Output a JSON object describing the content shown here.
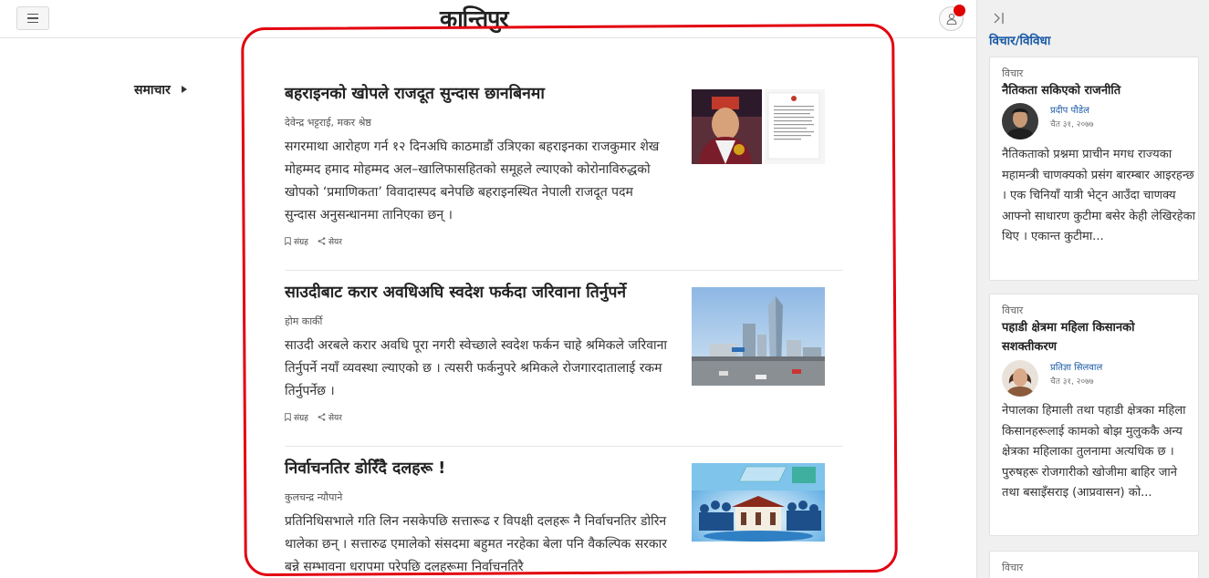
{
  "header": {
    "logo_text": "कान्तिपुर",
    "menu_icon": "hamburger-menu-icon",
    "user_icon": "user-icon"
  },
  "nav": {
    "section_label": "समाचार"
  },
  "articles": [
    {
      "title": "बहराइनको खोपले राजदूत सुन्दास छानबिनमा",
      "authors": "देवेन्द्र भट्टराई, मकर श्रेष्ठ",
      "summary": "सगरमाथा आरोहण गर्न १२ दिनअघि काठमाडौं उत्रिएका बहराइनका राजकुमार शेख मोहम्मद हमाद मोहम्मद अल–खालिफासहितको समूहले ल्याएको कोरोनाविरुद्धको खोपको ‘प्रमाणिकता’ विवादास्पद बनेपछि बहराइनस्थित नेपाली राजदूत पदम सुन्दास अनुसन्धानमा तानिएका छन् ।",
      "save_label": "संग्रह",
      "share_label": "सेयर"
    },
    {
      "title": "साउदीबाट करार अवधिअघि स्वदेश फर्कदा जरिवाना तिर्नुपर्ने",
      "authors": "होम कार्की",
      "summary": "साउदी अरबले करार अवधि पूरा नगरी स्वेच्छाले स्वदेश फर्कन चाहे श्रमिकले जरिवाना तिर्नुपर्ने नयाँ व्यवस्था ल्याएको छ । त्यसरी फर्कनुपरे श्रमिकले रोजगारदातालाई रकम तिर्नुपर्नेछ ।",
      "save_label": "संग्रह",
      "share_label": "सेयर"
    },
    {
      "title": "निर्वाचनतिर डोरिँदै दलहरू !",
      "authors": "कुलचन्द्र न्यौपाने",
      "summary": "प्रतिनिधिसभाले गति लिन नसकेपछि सत्तारूढ र विपक्षी दलहरू नै निर्वाचनतिर डोरिन थालेका छन् । सत्तारुढ एमालेको संसदमा बहुमत नरहेका बेला पनि वैकल्पिक सरकार बन्ने सम्भावना धरापमा परेपछि दलहरूमा निर्वाचनतिरै",
      "save_label": "संग्रह",
      "share_label": "सेयर"
    }
  ],
  "sidebar": {
    "title": "विचार/विविधा",
    "cards": [
      {
        "category": "विचार",
        "title": "नैतिकता सकिएको राजनीति",
        "author": "प्रदीप पौडेल",
        "date": "चैत ३१, २०७७",
        "excerpt": "नैतिकताको प्रश्नमा प्राचीन मगध राज्यका महामन्त्री चाणक्यको प्रसंग बारम्बार आइरहन्छ । एक चिनियाँ यात्री भेट्न आउँदा चाणक्य आफ्नो साधारण कुटीमा बसेर केही लेखिरहेका थिए । एकान्त कुटीमा..."
      },
      {
        "category": "विचार",
        "title": "पहाडी क्षेत्रमा महिला किसानको सशक्तीकरण",
        "author": "प्रतिज्ञा सिलवाल",
        "date": "चैत ३१, २०७७",
        "excerpt": "नेपालका हिमाली तथा पहाडी क्षेत्रका महिला किसानहरूलाई कामको बोझ मुलुककै अन्य क्षेत्रका महिलाका तुलनामा अत्यधिक छ । पुरुषहरू रोजगारीको खोजीमा बाहिर जाने तथा बसाइँसराइ (आप्रवासन) को..."
      },
      {
        "category": "विचार"
      }
    ]
  }
}
